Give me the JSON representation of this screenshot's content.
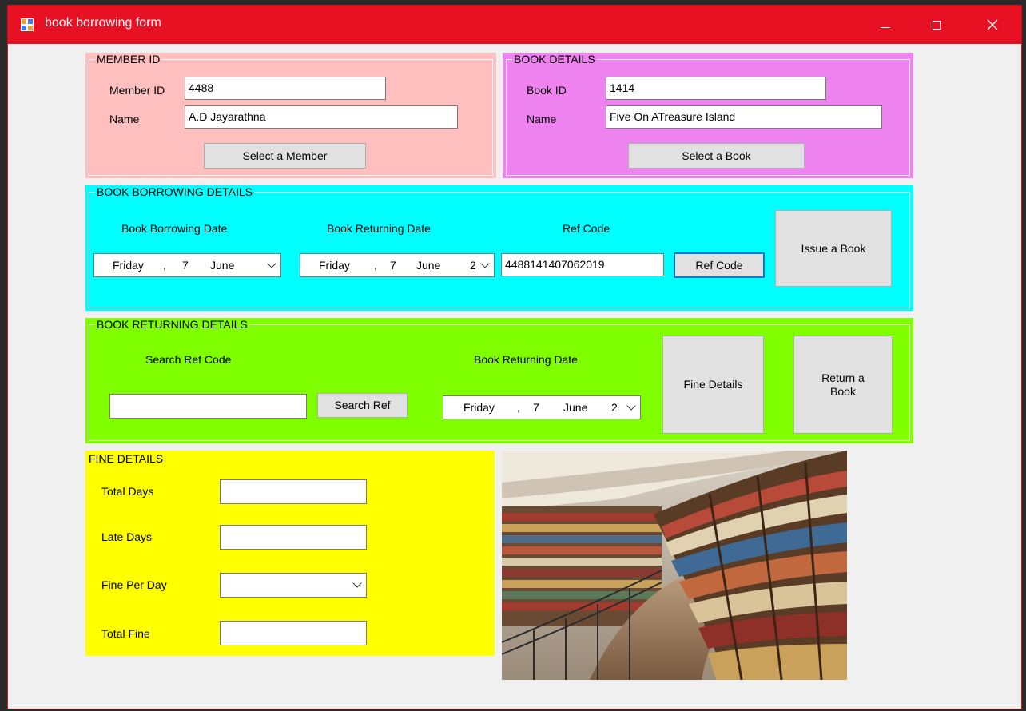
{
  "window": {
    "title": "book borrowing form"
  },
  "member": {
    "legend": "MEMBER ID",
    "id_label": "Member ID",
    "id_value": "4488",
    "name_label": "Name",
    "name_value": "A.D Jayarathna",
    "select_button": "Select a Member",
    "color": "#ffbfbf"
  },
  "book": {
    "legend": "BOOK DETAILS",
    "id_label": "Book ID",
    "id_value": "1414",
    "name_label": "Name",
    "name_value": "Five On ATreasure Island",
    "select_button": "Select a Book",
    "color": "#ee82ee"
  },
  "borrowing": {
    "legend": "BOOK BORROWING DETAILS",
    "borrow_date_label": "Book Borrowing Date",
    "borrow_date": {
      "day": "Friday",
      "sep": ",",
      "date": "7",
      "month": "June",
      "year": ""
    },
    "return_date_label": "Book Returning Date",
    "return_date": {
      "day": "Friday",
      "sep": ",",
      "date": "7",
      "month": "June",
      "year": "2"
    },
    "ref_label": "Ref Code",
    "ref_value": "4488141407062019",
    "ref_button": "Ref Code",
    "issue_button": "Issue a Book",
    "color": "#00ffff"
  },
  "returning": {
    "legend": "BOOK RETURNING DETAILS",
    "search_label": "Search Ref Code",
    "search_value": "",
    "search_button": "Search Ref",
    "return_date_label": "Book Returning Date",
    "return_date": {
      "day": "Friday",
      "sep": ",",
      "date": "7",
      "month": "June",
      "year": "2"
    },
    "fine_button": "Fine Details",
    "return_button_line1": "Return a",
    "return_button_line2": "Book",
    "color": "#80ff00"
  },
  "fine": {
    "legend": "FINE DETAILS",
    "total_days_label": "Total Days",
    "total_days_value": "",
    "late_days_label": "Late Days",
    "late_days_value": "",
    "fine_per_day_label": "Fine Per Day",
    "fine_per_day_value": "",
    "total_fine_label": "Total Fine",
    "total_fine_value": "",
    "color": "#ffff00"
  },
  "icons": {
    "app": "form-icon",
    "minimize": "minimize-icon",
    "maximize": "maximize-icon",
    "close": "close-icon",
    "dropdown": "chevron-down-icon"
  },
  "colors": {
    "titlebar": "#e81123",
    "window_bg": "#f0f0f0",
    "focus": "#0078d7"
  }
}
